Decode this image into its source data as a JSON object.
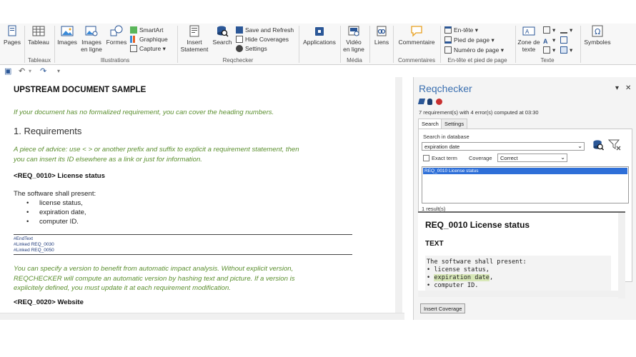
{
  "ribbon": {
    "groups": {
      "tableaux": "Tableaux",
      "illustrations": "Illustrations",
      "reqchecker": "Reqchecker",
      "media": "Média",
      "commentaires": "Commentaires",
      "entete": "En-tête et pied de page",
      "texte": "Texte"
    },
    "pages": "Pages",
    "tableau": "Tableau",
    "images": "Images",
    "images_en_ligne_1": "Images",
    "images_en_ligne_2": "en ligne",
    "formes": "Formes",
    "smartart": "SmartArt",
    "graphique": "Graphique",
    "capture": "Capture",
    "insert_statement_1": "Insert",
    "insert_statement_2": "Statement",
    "search": "Search",
    "save_refresh": "Save and Refresh",
    "hide_coverages": "Hide Coverages",
    "settings": "Settings",
    "applications": "Applications",
    "video_1": "Vidéo",
    "video_2": "en ligne",
    "liens": "Liens",
    "commentaire": "Commentaire",
    "entete": "En-tête",
    "pied": "Pied de page",
    "numero": "Numéro de page",
    "zone_1": "Zone de",
    "zone_2": "texte",
    "symboles": "Symboles"
  },
  "document": {
    "title": "UPSTREAM DOCUMENT SAMPLE",
    "p1": "If your document has no formalized requirement, you can cover the heading numbers.",
    "h1": "1. Requirements",
    "p2a": "A piece of advice: use < > or another prefix and suffix to explicit a requirement statement, then",
    "p2b": "you can insert its ID elsewhere as a link or just for information.",
    "req1_id": "<REQ_0010>",
    "req1_name": " License status",
    "intro": "The software shall present:",
    "bullets": [
      "license status,",
      "expiration date,",
      "computer ID."
    ],
    "tag1": "#EndText",
    "tag2": "#Linked REQ_0030",
    "tag3": "#Linked REQ_0050",
    "p3a": "You can specify a version to benefit from automatic impact analysis. Without explicit version,",
    "p3b": "REQCHECKER will compute an automatic version by hashing text and picture. If a version is",
    "p3c": "explicitely defined, you must update it at each requirement modification.",
    "req2_id": "<REQ_0020>",
    "req2_name": " Website"
  },
  "pane": {
    "title": "Reqchecker",
    "status": "7 requirement(s) with 4 error(s) computed at 03:30",
    "tab_search": "Search",
    "tab_settings": "Settings",
    "search_label": "Search in database",
    "search_value": "expiration date",
    "exact_term": "Exact term",
    "coverage_label": "Coverage",
    "coverage_value": "Correct",
    "result_item": "REQ_0010 License status",
    "result_count": "1 result(s)",
    "preview_title": "REQ_0010 License status",
    "preview_sub": "TEXT",
    "preview_line1": "The software shall present:",
    "preview_line2": "• license status,",
    "preview_hl": "expiration date",
    "preview_line4": "• computer ID.",
    "insert_coverage": "Insert Coverage"
  },
  "colors": {
    "accent": "#3a6fb0",
    "green_text": "#5b8f2f",
    "selection": "#2e6fd8"
  }
}
